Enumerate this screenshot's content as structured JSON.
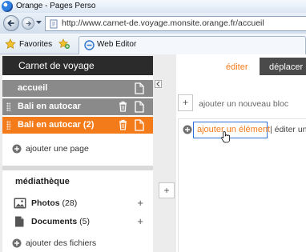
{
  "browser": {
    "window_title": "Orange - Pages Perso",
    "address": "http://www.carnet-de.voyage.monsite.orange.fr/accueil",
    "favorites_label": "Favorites",
    "tab_label": "Web Editor"
  },
  "header": {
    "site_title": "Carnet de voyage",
    "tabs": [
      {
        "label": "éditer",
        "active": true
      },
      {
        "label": "déplacer",
        "active": false
      }
    ]
  },
  "sidebar": {
    "pages": [
      {
        "label": "accueil",
        "active": false
      },
      {
        "label": "Bali en autocar",
        "active": false
      },
      {
        "label": "Bali en autocar (2)",
        "active": true
      }
    ],
    "add_page_label": "ajouter une page",
    "media": {
      "heading": "médiathèque",
      "items": [
        {
          "name": "Photos",
          "count": "(28)"
        },
        {
          "name": "Documents",
          "count": "(5)"
        }
      ],
      "add_files_label": "ajouter des fichiers"
    }
  },
  "content": {
    "add_block_label": "ajouter un nouveau bloc",
    "add_element_label": "ajouter un élément",
    "edit_label": "| éditer un"
  },
  "colors": {
    "accent": "#f47b1a",
    "dark_header": "#2b2b2b",
    "page_row_gray": "#8a8a8a",
    "focus_blue": "#2f6fd6"
  }
}
